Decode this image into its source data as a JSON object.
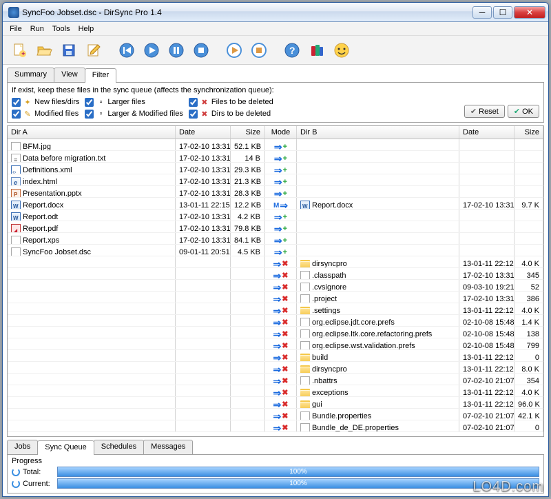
{
  "window": {
    "title": "SyncFoo Jobset.dsc - DirSync Pro 1.4"
  },
  "menubar": [
    "File",
    "Run",
    "Tools",
    "Help"
  ],
  "filter_tabs": [
    {
      "label": "Summary",
      "active": false
    },
    {
      "label": "View",
      "active": false
    },
    {
      "label": "Filter",
      "active": true
    }
  ],
  "filter": {
    "label": "If exist, keep these files in the sync queue (affects the synchronization queue):",
    "col1": [
      "New files/dirs",
      "Modified files"
    ],
    "col2": [
      "Larger files",
      "Larger & Modified files"
    ],
    "col3": [
      "Files to be deleted",
      "Dirs to be deleted"
    ],
    "reset": "Reset",
    "ok": "OK"
  },
  "grid": {
    "headers": {
      "dira": "Dir A",
      "date": "Date",
      "size": "Size",
      "mode": "Mode",
      "dirb": "Dir B",
      "date2": "Date",
      "size2": "Size"
    },
    "rows": [
      {
        "a": "BFM.jpg",
        "aicon": "generic",
        "adate": "17-02-10 13:31",
        "asize": "52.1 KB",
        "mode": "copy",
        "b": "",
        "bicon": "",
        "bdate": "",
        "bsize": ""
      },
      {
        "a": "Data before migration.txt",
        "aicon": "txt",
        "adate": "17-02-10 13:31",
        "asize": "14 B",
        "mode": "copy",
        "b": "",
        "bicon": "",
        "bdate": "",
        "bsize": ""
      },
      {
        "a": "Definitions.xml",
        "aicon": "xml",
        "adate": "17-02-10 13:31",
        "asize": "29.3 KB",
        "mode": "copy",
        "b": "",
        "bicon": "",
        "bdate": "",
        "bsize": ""
      },
      {
        "a": "index.html",
        "aicon": "html",
        "adate": "17-02-10 13:31",
        "asize": "21.3 KB",
        "mode": "copy",
        "b": "",
        "bicon": "",
        "bdate": "",
        "bsize": ""
      },
      {
        "a": "Presentation.pptx",
        "aicon": "ppt",
        "adate": "17-02-10 13:31",
        "asize": "28.3 KB",
        "mode": "copy",
        "b": "",
        "bicon": "",
        "bdate": "",
        "bsize": ""
      },
      {
        "a": "Report.docx",
        "aicon": "word",
        "adate": "13-01-11 22:15",
        "asize": "12.2 KB",
        "mode": "modify",
        "b": "Report.docx",
        "bicon": "word",
        "bdate": "17-02-10 13:31",
        "bsize": "9.7 K"
      },
      {
        "a": "Report.odt",
        "aicon": "word",
        "adate": "17-02-10 13:31",
        "asize": "4.2 KB",
        "mode": "copy",
        "b": "",
        "bicon": "",
        "bdate": "",
        "bsize": ""
      },
      {
        "a": "Report.pdf",
        "aicon": "pdf",
        "adate": "17-02-10 13:31",
        "asize": "79.8 KB",
        "mode": "copy",
        "b": "",
        "bicon": "",
        "bdate": "",
        "bsize": ""
      },
      {
        "a": "Report.xps",
        "aicon": "generic",
        "adate": "17-02-10 13:31",
        "asize": "84.1 KB",
        "mode": "copy",
        "b": "",
        "bicon": "",
        "bdate": "",
        "bsize": ""
      },
      {
        "a": "SyncFoo Jobset.dsc",
        "aicon": "generic",
        "adate": "09-01-11 20:51",
        "asize": "4.5 KB",
        "mode": "copy",
        "b": "",
        "bicon": "",
        "bdate": "",
        "bsize": ""
      },
      {
        "a": "",
        "aicon": "",
        "adate": "",
        "asize": "",
        "mode": "delete",
        "b": "dirsyncpro",
        "bicon": "folder",
        "bdate": "13-01-11 22:12",
        "bsize": "4.0 K"
      },
      {
        "a": "",
        "aicon": "",
        "adate": "",
        "asize": "",
        "mode": "delete",
        "b": ".classpath",
        "bicon": "generic",
        "bdate": "17-02-10 13:31",
        "bsize": "345 "
      },
      {
        "a": "",
        "aicon": "",
        "adate": "",
        "asize": "",
        "mode": "delete",
        "b": ".cvsignore",
        "bicon": "generic",
        "bdate": "09-03-10 19:21",
        "bsize": "52 "
      },
      {
        "a": "",
        "aicon": "",
        "adate": "",
        "asize": "",
        "mode": "delete",
        "b": ".project",
        "bicon": "generic",
        "bdate": "17-02-10 13:31",
        "bsize": "386 "
      },
      {
        "a": "",
        "aicon": "",
        "adate": "",
        "asize": "",
        "mode": "delete",
        "b": ".settings",
        "bicon": "folder",
        "bdate": "13-01-11 22:12",
        "bsize": "4.0 K"
      },
      {
        "a": "",
        "aicon": "",
        "adate": "",
        "asize": "",
        "mode": "delete",
        "b": "org.eclipse.jdt.core.prefs",
        "bicon": "generic",
        "bdate": "02-10-08 15:48",
        "bsize": "1.4 K"
      },
      {
        "a": "",
        "aicon": "",
        "adate": "",
        "asize": "",
        "mode": "delete",
        "b": "org.eclipse.ltk.core.refactoring.prefs",
        "bicon": "generic",
        "bdate": "02-10-08 15:48",
        "bsize": "138 "
      },
      {
        "a": "",
        "aicon": "",
        "adate": "",
        "asize": "",
        "mode": "delete",
        "b": "org.eclipse.wst.validation.prefs",
        "bicon": "generic",
        "bdate": "02-10-08 15:48",
        "bsize": "799 "
      },
      {
        "a": "",
        "aicon": "",
        "adate": "",
        "asize": "",
        "mode": "delete",
        "b": "build",
        "bicon": "folder",
        "bdate": "13-01-11 22:12",
        "bsize": "0 "
      },
      {
        "a": "",
        "aicon": "",
        "adate": "",
        "asize": "",
        "mode": "delete",
        "b": "dirsyncpro",
        "bicon": "folder",
        "bdate": "13-01-11 22:12",
        "bsize": "8.0 K"
      },
      {
        "a": "",
        "aicon": "",
        "adate": "",
        "asize": "",
        "mode": "delete",
        "b": ".nbattrs",
        "bicon": "generic",
        "bdate": "07-02-10 21:07",
        "bsize": "354 "
      },
      {
        "a": "",
        "aicon": "",
        "adate": "",
        "asize": "",
        "mode": "delete",
        "b": "exceptions",
        "bicon": "folder",
        "bdate": "13-01-11 22:12",
        "bsize": "4.0 K"
      },
      {
        "a": "",
        "aicon": "",
        "adate": "",
        "asize": "",
        "mode": "delete",
        "b": "gui",
        "bicon": "folder",
        "bdate": "13-01-11 22:12",
        "bsize": "96.0 K"
      },
      {
        "a": "",
        "aicon": "",
        "adate": "",
        "asize": "",
        "mode": "delete",
        "b": "Bundle.properties",
        "bicon": "generic",
        "bdate": "07-02-10 21:07",
        "bsize": "42.1 K"
      },
      {
        "a": "",
        "aicon": "",
        "adate": "",
        "asize": "",
        "mode": "delete",
        "b": "Bundle_de_DE.properties",
        "bicon": "generic",
        "bdate": "07-02-10 21:07",
        "bsize": "0 "
      }
    ]
  },
  "bottom_tabs": [
    {
      "label": "Jobs",
      "active": false
    },
    {
      "label": "Sync Queue",
      "active": true
    },
    {
      "label": "Schedules",
      "active": false
    },
    {
      "label": "Messages",
      "active": false
    }
  ],
  "progress": {
    "title": "Progress",
    "total_label": "Total:",
    "current_label": "Current:",
    "pct": "100%"
  },
  "watermark": "LO4D.com"
}
